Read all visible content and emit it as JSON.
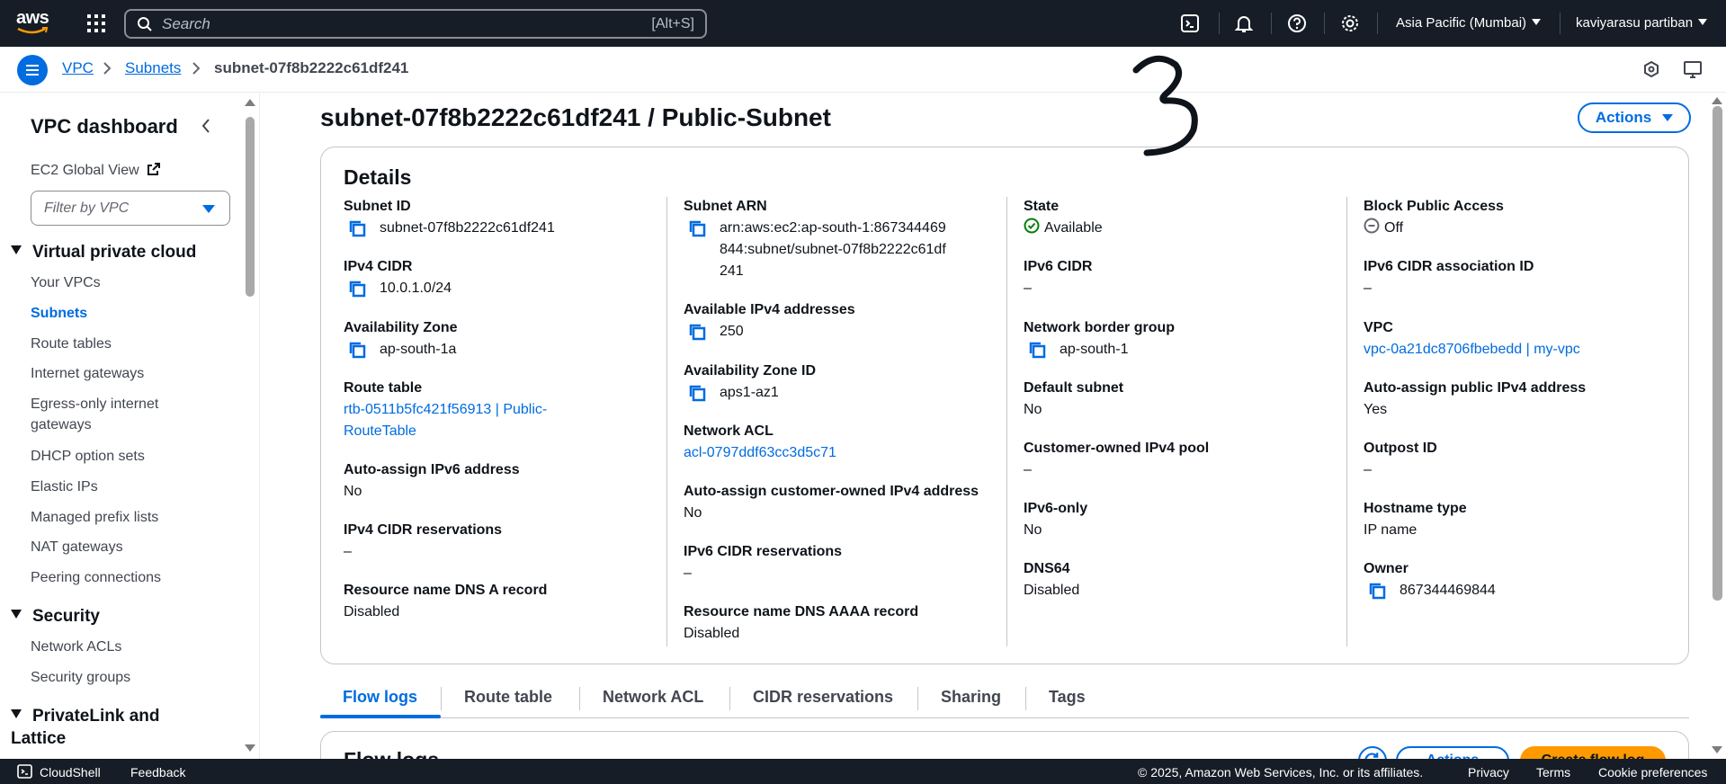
{
  "topnav": {
    "logo_text": "aws",
    "search_placeholder": "Search",
    "search_shortcut": "[Alt+S]",
    "region": "Asia Pacific (Mumbai)",
    "user": "kaviyarasu partiban"
  },
  "breadcrumb": {
    "items": [
      "VPC",
      "Subnets"
    ],
    "current": "subnet-07f8b2222c61df241"
  },
  "sidebar": {
    "title": "VPC dashboard",
    "ec2_global_view": "EC2 Global View",
    "filter_placeholder": "Filter by VPC",
    "sections": {
      "virtual_private_cloud": "Virtual private cloud",
      "security": "Security",
      "privatelink": "PrivateLink and Lattice"
    },
    "vpc_items": [
      "Your VPCs",
      "Subnets",
      "Route tables",
      "Internet gateways",
      "Egress-only internet gateways",
      "DHCP option sets",
      "Elastic IPs",
      "Managed prefix lists",
      "NAT gateways",
      "Peering connections"
    ],
    "security_items": [
      "Network ACLs",
      "Security groups"
    ]
  },
  "page": {
    "title": "subnet-07f8b2222c61df241 / Public-Subnet",
    "actions_label": "Actions"
  },
  "details": {
    "heading": "Details",
    "col1": {
      "subnet_id_label": "Subnet ID",
      "subnet_id": "subnet-07f8b2222c61df241",
      "ipv4_cidr_label": "IPv4 CIDR",
      "ipv4_cidr": "10.0.1.0/24",
      "az_label": "Availability Zone",
      "az": "ap-south-1a",
      "route_table_label": "Route table",
      "route_table": "rtb-0511b5fc421f56913 | Public-RouteTable",
      "auto_ipv6_label": "Auto-assign IPv6 address",
      "auto_ipv6": "No",
      "ipv4_res_label": "IPv4 CIDR reservations",
      "ipv4_res": "–",
      "dns_a_label": "Resource name DNS A record",
      "dns_a": "Disabled"
    },
    "col2": {
      "arn_label": "Subnet ARN",
      "arn": "arn:aws:ec2:ap-south-1:867344469844:subnet/subnet-07f8b2222c61df241",
      "avail_ipv4_label": "Available IPv4 addresses",
      "avail_ipv4": "250",
      "az_id_label": "Availability Zone ID",
      "az_id": "aps1-az1",
      "nacl_label": "Network ACL",
      "nacl": "acl-0797ddf63cc3d5c71",
      "auto_cust_label": "Auto-assign customer-owned IPv4 address",
      "auto_cust": "No",
      "ipv6_res_label": "IPv6 CIDR reservations",
      "ipv6_res": "–",
      "dns_aaaa_label": "Resource name DNS AAAA record",
      "dns_aaaa": "Disabled"
    },
    "col3": {
      "state_label": "State",
      "state": "Available",
      "ipv6_cidr_label": "IPv6 CIDR",
      "ipv6_cidr": "–",
      "nbg_label": "Network border group",
      "nbg": "ap-south-1",
      "default_label": "Default subnet",
      "default": "No",
      "cust_pool_label": "Customer-owned IPv4 pool",
      "cust_pool": "–",
      "ipv6_only_label": "IPv6-only",
      "ipv6_only": "No",
      "dns64_label": "DNS64",
      "dns64": "Disabled"
    },
    "col4": {
      "bpa_label": "Block Public Access",
      "bpa": "Off",
      "ipv6_assoc_label": "IPv6 CIDR association ID",
      "ipv6_assoc": "–",
      "vpc_label": "VPC",
      "vpc": "vpc-0a21dc8706fbebedd | my-vpc",
      "auto_pub_label": "Auto-assign public IPv4 address",
      "auto_pub": "Yes",
      "outpost_label": "Outpost ID",
      "outpost": "–",
      "hostname_label": "Hostname type",
      "hostname": "IP name",
      "owner_label": "Owner",
      "owner": "867344469844"
    }
  },
  "tabs": [
    "Flow logs",
    "Route table",
    "Network ACL",
    "CIDR reservations",
    "Sharing",
    "Tags"
  ],
  "flow_logs": {
    "heading": "Flow logs",
    "actions_label": "Actions",
    "create_label": "Create flow log"
  },
  "footer": {
    "cloudshell": "CloudShell",
    "feedback": "Feedback",
    "copyright": "© 2025, Amazon Web Services, Inc. or its affiliates.",
    "privacy": "Privacy",
    "terms": "Terms",
    "cookies": "Cookie preferences"
  },
  "colors": {
    "nav_bg": "#161d26",
    "link": "#006ce0",
    "success": "#037f0c",
    "primary_button": "#ff9900"
  }
}
